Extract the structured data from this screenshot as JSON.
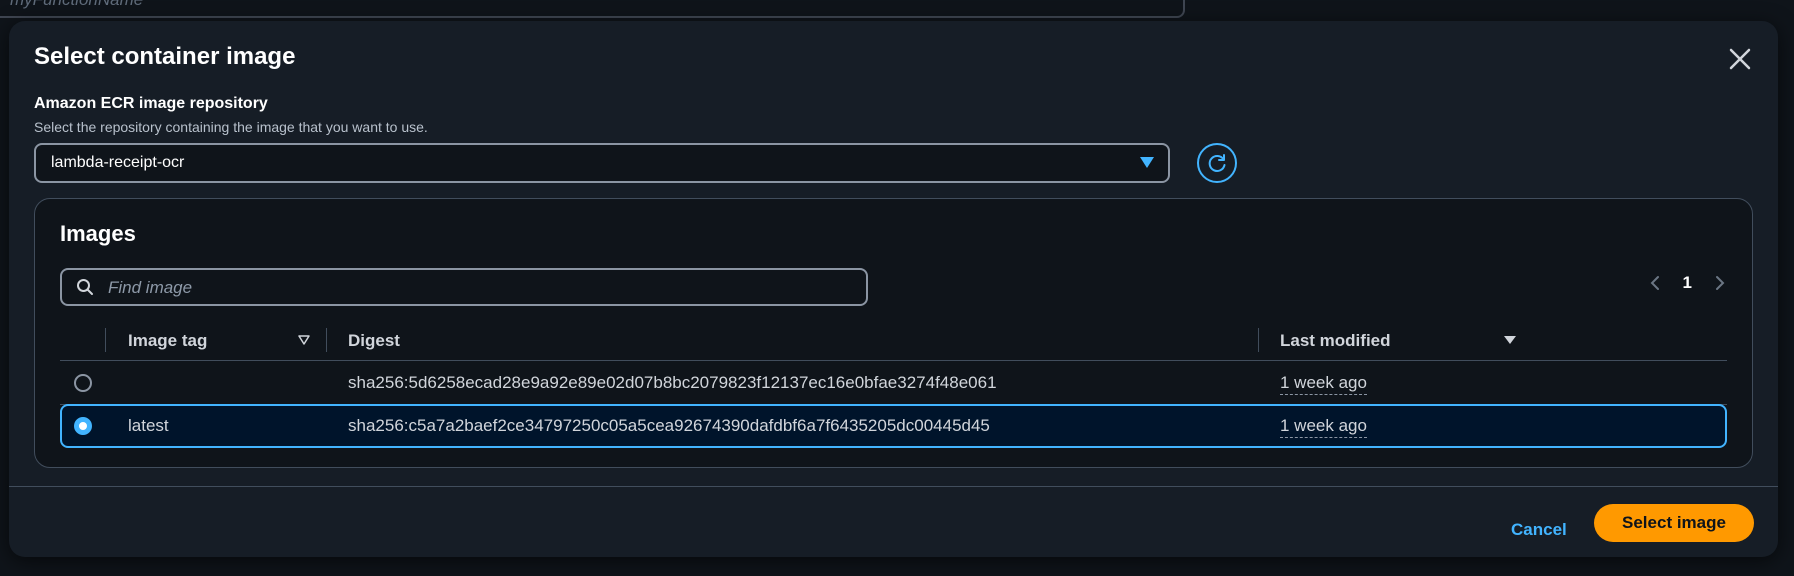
{
  "background": {
    "function_name_placeholder": "myFunctionName"
  },
  "modal": {
    "title": "Select container image",
    "repository": {
      "label": "Amazon ECR image repository",
      "description": "Select the repository containing the image that you want to use.",
      "selected_value": "lambda-receipt-ocr"
    },
    "images": {
      "title": "Images",
      "search_placeholder": "Find image",
      "pagination": {
        "current_page": "1"
      },
      "columns": {
        "image_tag": "Image tag",
        "digest": "Digest",
        "last_modified": "Last modified"
      },
      "rows": [
        {
          "selected": false,
          "image_tag": "",
          "digest": "sha256:5d6258ecad28e9a92e89e02d07b8bc2079823f12137ec16e0bfae3274f48e061",
          "last_modified": "1 week ago"
        },
        {
          "selected": true,
          "image_tag": "latest",
          "digest": "sha256:c5a7a2baef2ce34797250c05a5cea92674390dafdbf6a7f6435205dc00445d45",
          "last_modified": "1 week ago"
        }
      ]
    },
    "footer": {
      "cancel_label": "Cancel",
      "submit_label": "Select image"
    }
  },
  "colors": {
    "accent": "#42b4ff",
    "primary_button": "#ff9900",
    "modal_bg": "#161d26",
    "page_bg": "#0f141a"
  }
}
